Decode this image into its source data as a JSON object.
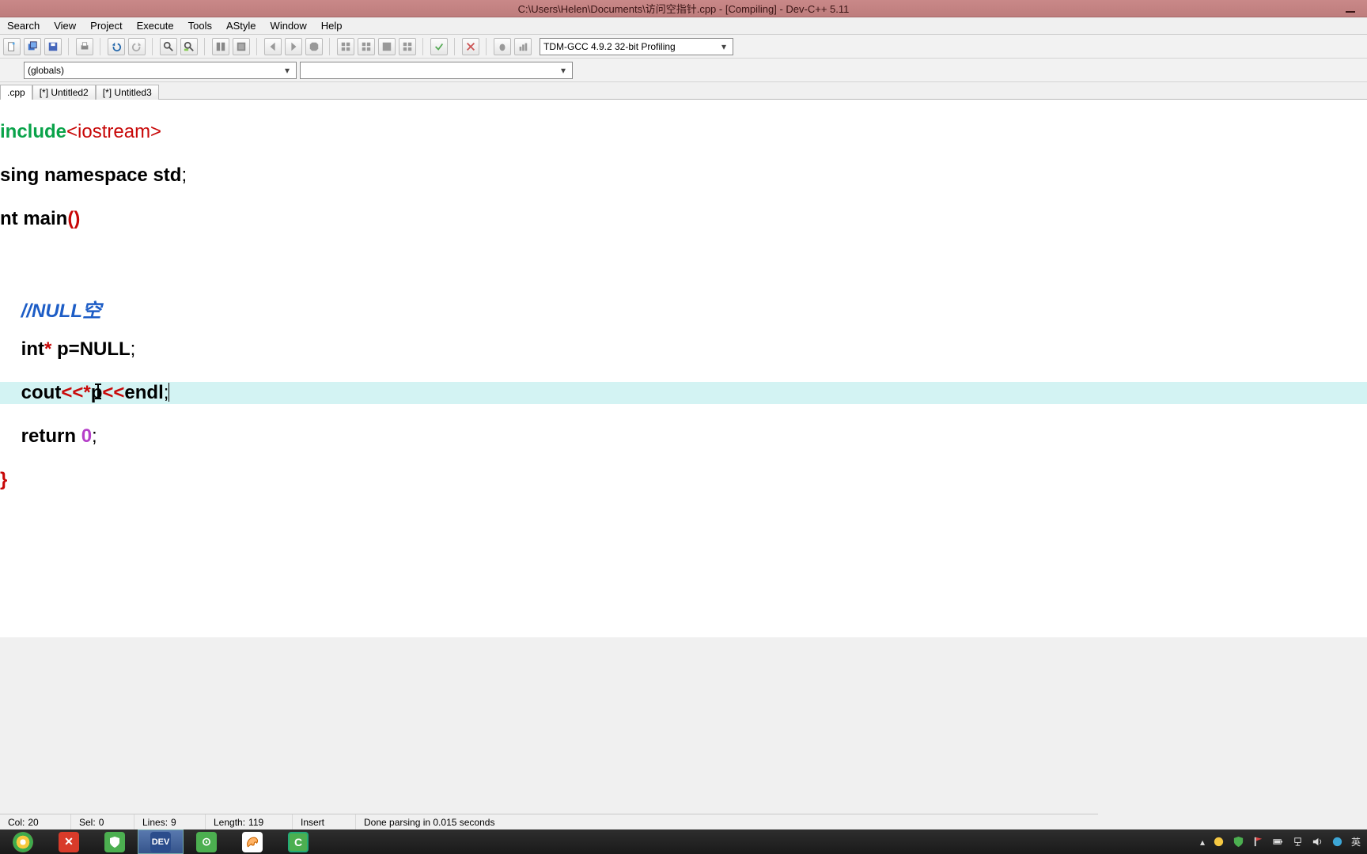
{
  "window": {
    "title": "C:\\Users\\Helen\\Documents\\访问空指针.cpp - [Compiling] - Dev-C++ 5.11"
  },
  "menu": {
    "items": [
      "Search",
      "View",
      "Project",
      "Execute",
      "Tools",
      "AStyle",
      "Window",
      "Help"
    ]
  },
  "toolbar": {
    "compiler_combo": "TDM-GCC 4.9.2 32-bit Profiling"
  },
  "classbar": {
    "scope_combo": "(globals)",
    "member_combo": ""
  },
  "tabs": [
    {
      "label": ".cpp",
      "active": true
    },
    {
      "label": "[*] Untitled2",
      "active": false
    },
    {
      "label": "[*] Untitled3",
      "active": false
    }
  ],
  "code": {
    "l1_include": "include",
    "l1_header": "<iostream>",
    "l2_using": "sing ",
    "l2_namespace": "namespace ",
    "l2_std": "std",
    "l3_int": "nt ",
    "l3_main": "main",
    "l5_comment": "//NULL空",
    "l6_int": "int",
    "l6_rest": " p=NULL",
    "l7_cout": "cout",
    "l7_p": "p",
    "l7_endl": "endl",
    "l8_return": "return ",
    "l8_zero": "0"
  },
  "status": {
    "col_label": "Col:",
    "col_val": "20",
    "sel_label": "Sel:",
    "sel_val": "0",
    "lines_label": "Lines:",
    "lines_val": "9",
    "length_label": "Length:",
    "length_val": "119",
    "mode": "Insert",
    "msg": "Done parsing in 0.015 seconds"
  },
  "tray": {
    "ime": "英"
  }
}
